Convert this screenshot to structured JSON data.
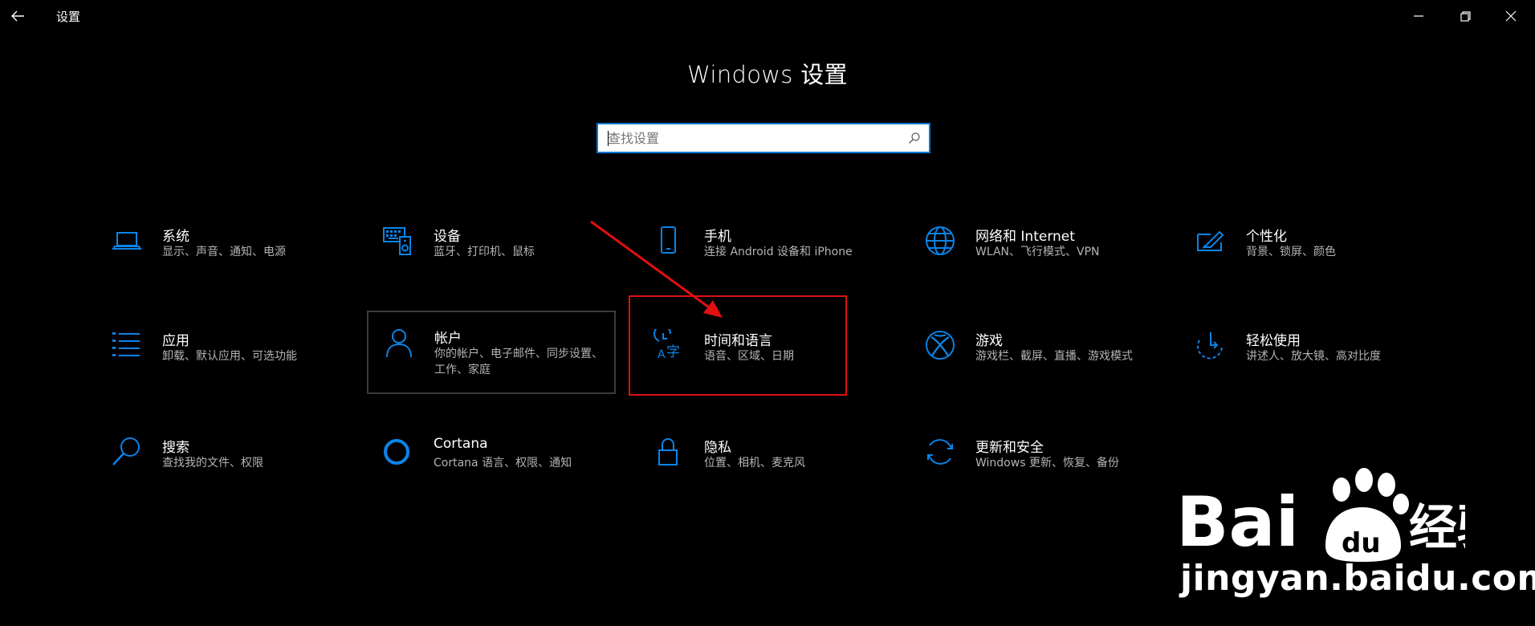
{
  "window": {
    "title": "设置"
  },
  "page": {
    "title": "Windows 设置"
  },
  "search": {
    "placeholder": "查找设置",
    "value": ""
  },
  "colors": {
    "accent": "#0078d7",
    "annotation": "#e01010"
  },
  "tiles": [
    {
      "title": "系统",
      "subtitle": "显示、声音、通知、电源",
      "icon": "laptop-icon"
    },
    {
      "title": "设备",
      "subtitle": "蓝牙、打印机、鼠标",
      "icon": "devices-icon"
    },
    {
      "title": "手机",
      "subtitle": "连接 Android 设备和 iPhone",
      "icon": "phone-icon"
    },
    {
      "title": "网络和 Internet",
      "subtitle": "WLAN、飞行模式、VPN",
      "icon": "globe-icon"
    },
    {
      "title": "个性化",
      "subtitle": "背景、锁屏、颜色",
      "icon": "personalization-icon"
    },
    {
      "title": "应用",
      "subtitle": "卸载、默认应用、可选功能",
      "icon": "apps-list-icon"
    },
    {
      "title": "帐户",
      "subtitle": "你的帐户、电子邮件、同步设置、工作、家庭",
      "icon": "person-icon"
    },
    {
      "title": "时间和语言",
      "subtitle": "语音、区域、日期",
      "icon": "time-language-icon"
    },
    {
      "title": "游戏",
      "subtitle": "游戏栏、截屏、直播、游戏模式",
      "icon": "xbox-icon"
    },
    {
      "title": "轻松使用",
      "subtitle": "讲述人、放大镜、高对比度",
      "icon": "ease-of-access-icon"
    },
    {
      "title": "搜索",
      "subtitle": "查找我的文件、权限",
      "icon": "search-icon"
    },
    {
      "title": "Cortana",
      "subtitle": "Cortana 语言、权限、通知",
      "icon": "cortana-icon"
    },
    {
      "title": "隐私",
      "subtitle": "位置、相机、麦克风",
      "icon": "lock-icon"
    },
    {
      "title": "更新和安全",
      "subtitle": "Windows 更新、恢复、备份",
      "icon": "update-icon"
    }
  ],
  "watermark": {
    "brand": "Bai 经验",
    "url": "jingyan.baidu.com"
  }
}
